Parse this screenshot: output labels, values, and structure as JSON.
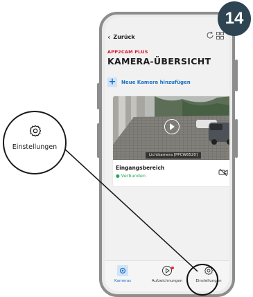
{
  "step_number": "14",
  "header": {
    "back_label": "Zurück",
    "app_name": "APP2CAM PLUS",
    "title": "KAMERA-ÜBERSICHT"
  },
  "add_camera_label": "Neue Kamera hinzufügen",
  "camera": {
    "caption": "Lichtkamera [PPCW6520]",
    "name": "Eingangsbereich",
    "status": "Verbunden"
  },
  "nav": {
    "cameras": "Kameras",
    "recordings": "Aufzeichnungen",
    "settings": "Einstellungen"
  },
  "callout_label": "Einstellungen",
  "colors": {
    "accent_blue": "#1a6fc4",
    "brand_red": "#d3182a",
    "status_green": "#1ea85a",
    "badge": "#2f4452"
  }
}
